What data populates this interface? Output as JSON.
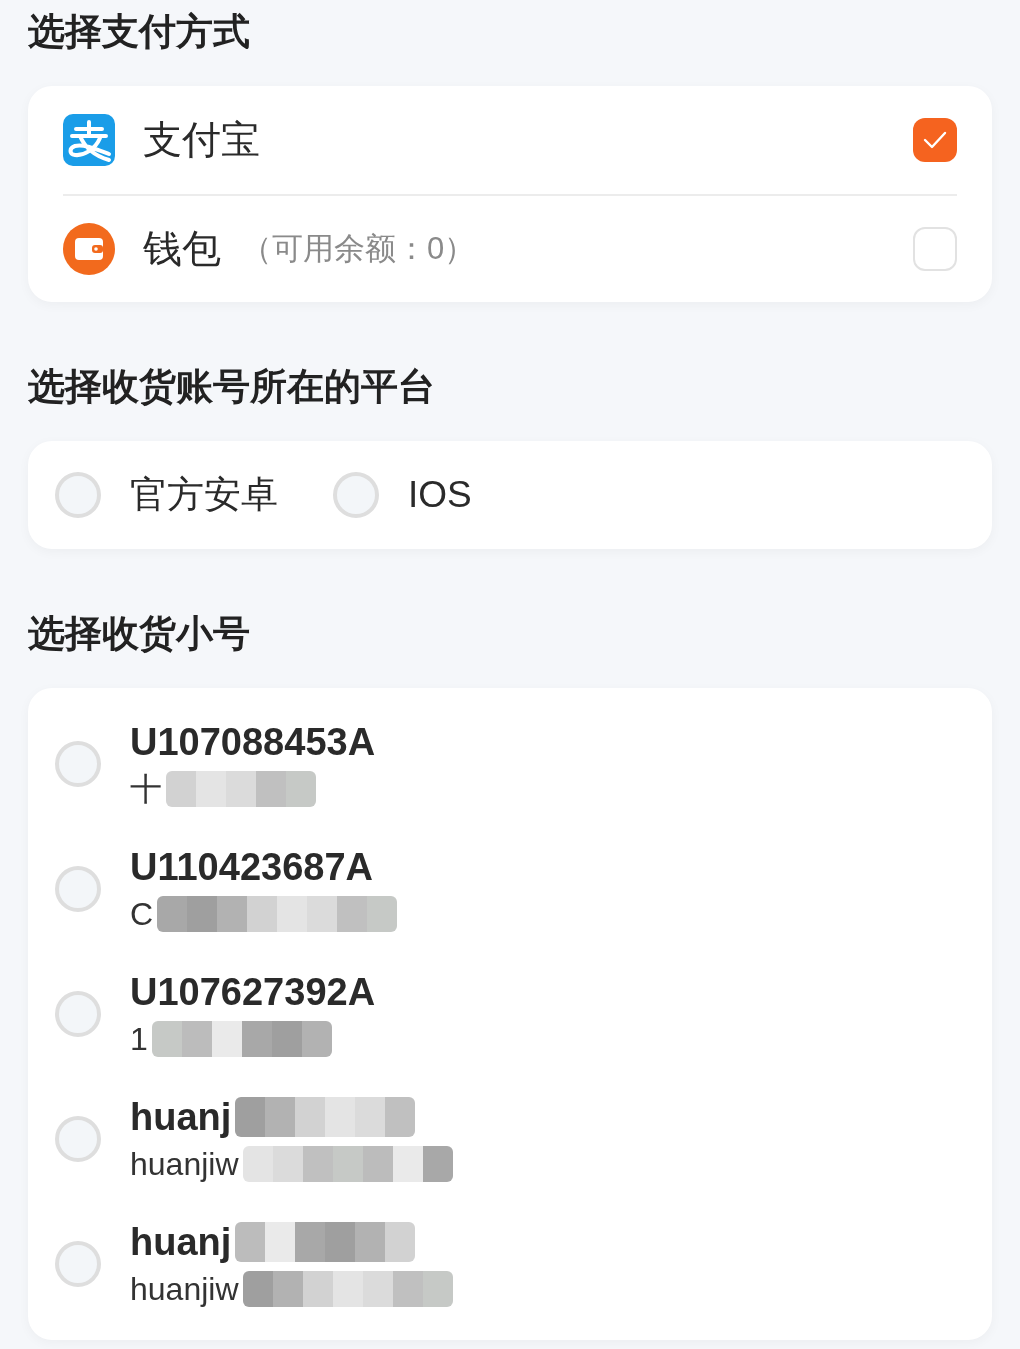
{
  "payment": {
    "title": "选择支付方式",
    "methods": [
      {
        "kind": "alipay",
        "label": "支付宝",
        "selected": true
      },
      {
        "kind": "wallet",
        "label": "钱包",
        "note": "（可用余额：0）",
        "selected": false
      }
    ]
  },
  "platform": {
    "title": "选择收货账号所在的平台",
    "options": [
      {
        "label": "官方安卓",
        "selected": false
      },
      {
        "label": "IOS",
        "selected": false
      }
    ]
  },
  "accounts": {
    "title": "选择收货小号",
    "items": [
      {
        "name": "U107088453A",
        "name_redacted": false,
        "detail": "十",
        "detail_redacted": true,
        "selected": false
      },
      {
        "name": "U110423687A",
        "name_redacted": false,
        "detail": "C",
        "detail_redacted": true,
        "selected": false
      },
      {
        "name": "U107627392A",
        "name_redacted": false,
        "detail": "1",
        "detail_redacted": true,
        "selected": false
      },
      {
        "name": "huanj",
        "name_redacted": true,
        "detail": "huanjiw",
        "detail_redacted": true,
        "selected": false
      },
      {
        "name": "huanj",
        "name_redacted": true,
        "detail": "huanjiw",
        "detail_redacted": true,
        "selected": false
      }
    ]
  }
}
